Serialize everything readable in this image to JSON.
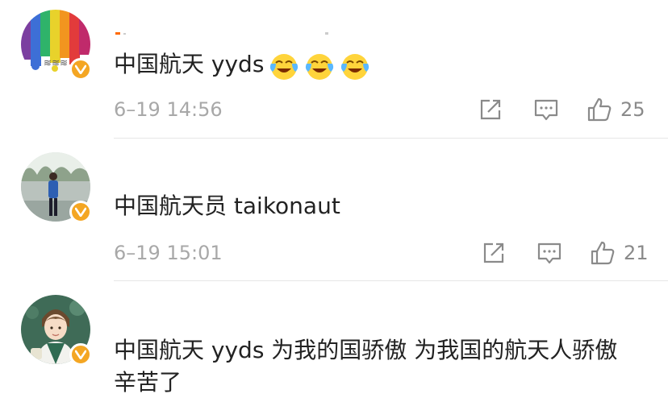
{
  "colors": {
    "text": "#222222",
    "meta_text": "#a8a8a8",
    "icon": "#8a8a8a",
    "verified_badge": "#f4a623",
    "divider": "#e6e6e6"
  },
  "comments": [
    {
      "text": "中国航天 yyds",
      "emoji_names": [
        "crying-laughing-emoji",
        "crying-laughing-emoji",
        "crying-laughing-emoji"
      ],
      "timestamp": "6–19 14:56",
      "likes": "25",
      "verified": true
    },
    {
      "text": "中国航天员 taikonaut",
      "timestamp": "6–19 15:01",
      "likes": "21",
      "verified": true
    },
    {
      "text": "中国航天 yyds 为我的国骄傲 为我国的航天人骄傲 辛苦了",
      "verified": true
    }
  ],
  "icons": {
    "share": "share-icon",
    "comment": "comment-icon",
    "like": "thumbs-up-icon",
    "verified": "verified-icon"
  }
}
